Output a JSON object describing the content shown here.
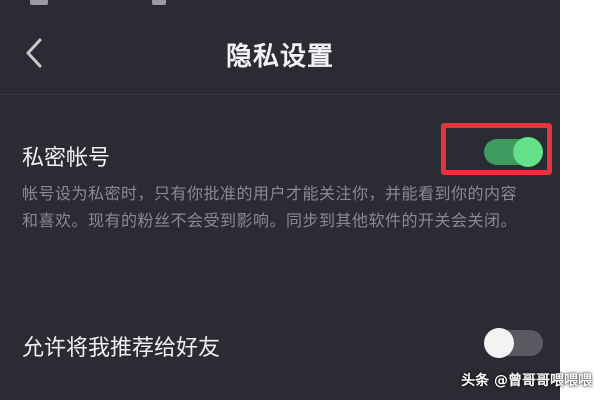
{
  "header": {
    "title": "隐私设置",
    "back_icon": "chevron-left-icon"
  },
  "private_account": {
    "label": "私密帐号",
    "description": "帐号设为私密时，只有你批准的用户才能关注你，并能看到你的内容和喜欢。现有的粉丝不会受到影响。同步到其他软件的开关会关闭。",
    "toggle_on": true
  },
  "recommend_to_friends": {
    "label": "允许将我推荐给好友",
    "toggle_on": false
  },
  "annotation": {
    "highlight_color": "#e5323b"
  },
  "watermark": {
    "text": "头条 @曾哥哥喂喂喂"
  },
  "colors": {
    "background": "#2b2b34",
    "toggle_on_track": "#3f9a60",
    "toggle_on_knob": "#62e08a",
    "toggle_off_track": "#5a5a63"
  }
}
